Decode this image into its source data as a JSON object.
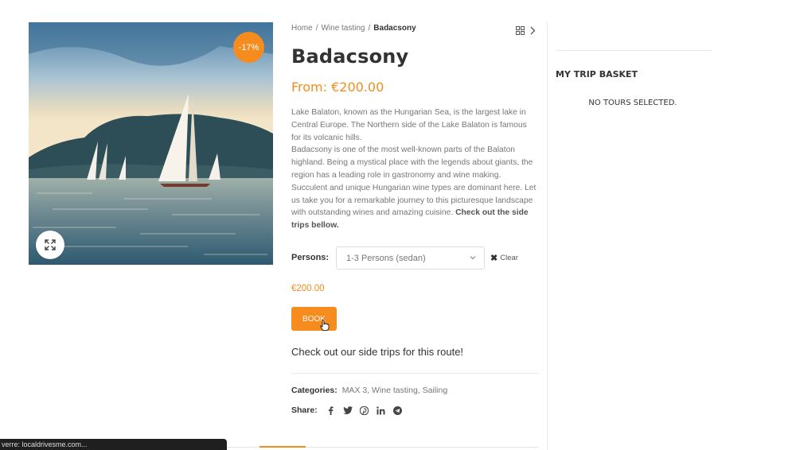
{
  "product": {
    "sale_badge": "-17%",
    "title": "Badacsony",
    "price_range": "From: €200.00",
    "description_p1": "Lake Balaton, known as the Hungarian Sea, is the largest lake in Central Europe. The Northern side of the Lake Balaton is famous for its volcanic hills.",
    "description_p2": "Badacsony is one of the most well-known parts of the Balaton highland. Being a mystical place with the legends about giants, the region has a leading role in gastronomy and wine making. Succulent and unique Hungarian wine types are dominant here. Let us take you for a remarkable journey to this picturesque landscape with outstanding wines and amazing cuisine.",
    "description_bold": "Check out the side trips bellow.",
    "image_icon": "landscape-sailboats"
  },
  "breadcrumb": {
    "home": "Home",
    "category": "Wine tasting",
    "current": "Badacsony",
    "separator": "/"
  },
  "variation": {
    "persons_label": "Persons",
    "persons_selected": "1-3 Persons (sedan)",
    "clear_label": "Clear",
    "price": "€200.00",
    "book_label": "BOOK"
  },
  "side_trips_heading": "Check out our side trips for this route!",
  "meta": {
    "categories_label": "Categories:",
    "categories": [
      "MAX 3",
      "Wine tasting",
      "Sailing"
    ],
    "share_label": "Share:",
    "share_icons": [
      "facebook-icon",
      "twitter-icon",
      "pinterest-icon",
      "linkedin-icon",
      "telegram-icon"
    ]
  },
  "sidebar": {
    "basket_title": "MY TRIP BASKET",
    "basket_empty": "NO TOURS SELECTED."
  },
  "status_bar": {
    "text": "verre: localdrivesme.com..."
  },
  "colors": {
    "accent": "#f68c1e",
    "text": "#333333",
    "muted": "#777777"
  }
}
